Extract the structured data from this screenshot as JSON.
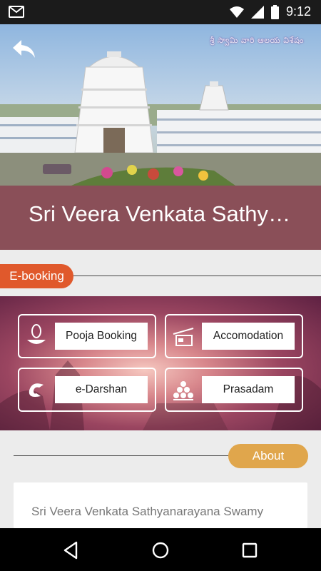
{
  "status_bar": {
    "time": "9:12",
    "icons": [
      "gmail-icon",
      "wifi-icon",
      "signal-icon",
      "battery-icon"
    ]
  },
  "hero": {
    "telugu_caption": "శ్రీ స్వామి వారి ఆలయ విశేషం",
    "back_icon": "back-arrow-icon"
  },
  "title": "Sri Veera Venkata Sathyanarayana Swamy",
  "sections": {
    "ebooking_label": "E-booking",
    "about_label": "About"
  },
  "ebooking": {
    "items": [
      {
        "label": "Pooja Booking",
        "icon": "lamp-icon"
      },
      {
        "label": "Accomodation",
        "icon": "bed-icon"
      },
      {
        "label": "e-Darshan",
        "icon": "e-logo-icon"
      },
      {
        "label": "Prasadam",
        "icon": "laddu-stack-icon"
      }
    ]
  },
  "about": {
    "text": "Sri Veera Venkata Sathyanarayana Swamy"
  },
  "colors": {
    "status_bar": "#1b1b1b",
    "title_band": "#8a4f58",
    "ebooking_pill": "#e0592c",
    "about_pill": "#e0a64c"
  }
}
